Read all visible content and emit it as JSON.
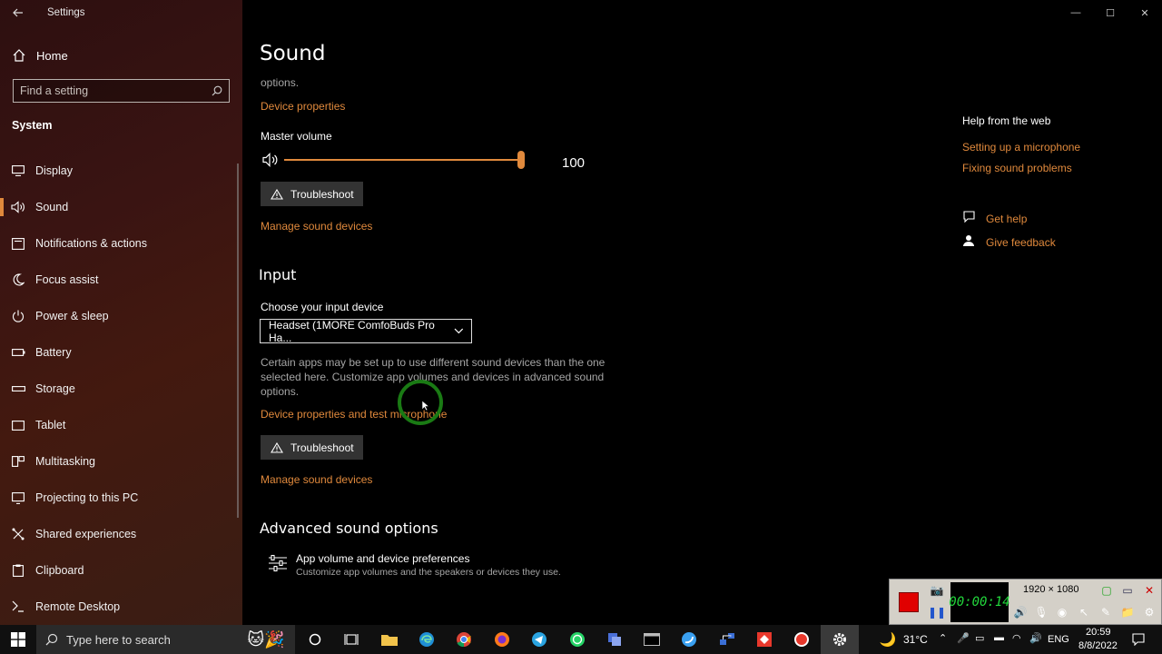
{
  "window": {
    "title": "Settings",
    "minimize": "—",
    "maximize": "☐",
    "close": "✕"
  },
  "sidebar": {
    "home": "Home",
    "search_placeholder": "Find a setting",
    "section": "System",
    "items": [
      {
        "label": "Display",
        "icon": "display-icon"
      },
      {
        "label": "Sound",
        "icon": "speaker-icon",
        "active": true
      },
      {
        "label": "Notifications & actions",
        "icon": "notification-icon"
      },
      {
        "label": "Focus assist",
        "icon": "moon-icon"
      },
      {
        "label": "Power & sleep",
        "icon": "power-icon"
      },
      {
        "label": "Battery",
        "icon": "battery-icon"
      },
      {
        "label": "Storage",
        "icon": "storage-icon"
      },
      {
        "label": "Tablet",
        "icon": "tablet-icon"
      },
      {
        "label": "Multitasking",
        "icon": "multitasking-icon"
      },
      {
        "label": "Projecting to this PC",
        "icon": "projecting-icon"
      },
      {
        "label": "Shared experiences",
        "icon": "shared-icon"
      },
      {
        "label": "Clipboard",
        "icon": "clipboard-icon"
      },
      {
        "label": "Remote Desktop",
        "icon": "remote-icon"
      }
    ]
  },
  "main": {
    "title": "Sound",
    "output": {
      "options_tail": "options.",
      "device_properties": "Device properties",
      "master_volume_label": "Master volume",
      "volume_value": "100",
      "volume_fraction": 1.0,
      "troubleshoot": "Troubleshoot",
      "manage_devices": "Manage sound devices"
    },
    "input": {
      "heading": "Input",
      "choose_label": "Choose your input device",
      "selected_device": "Headset (1MORE ComfoBuds Pro Ha...",
      "description_line1": "Certain apps may be set up to use different sound devices than the one",
      "description_line2": "selected here. Customize app volumes and devices in advanced sound",
      "description_line3": "options.",
      "device_properties": "Device properties and test microphone",
      "troubleshoot": "Troubleshoot",
      "manage_devices": "Manage sound devices"
    },
    "advanced": {
      "heading": "Advanced sound options",
      "item_title": "App volume and device preferences",
      "item_desc": "Customize app volumes and the speakers or devices they use."
    }
  },
  "right_panel": {
    "help_heading": "Help from the web",
    "links": [
      "Setting up a microphone",
      "Fixing sound problems"
    ],
    "get_help": "Get help",
    "give_feedback": "Give feedback"
  },
  "recorder": {
    "timer": "00:00:14",
    "resolution": "1920 × 1080"
  },
  "taskbar": {
    "search_placeholder": "Type here to search",
    "temperature": "31°C",
    "language": "ENG",
    "time": "20:59",
    "date": "8/8/2022"
  },
  "colors": {
    "accent": "#e0893c",
    "link": "#e0893c"
  }
}
